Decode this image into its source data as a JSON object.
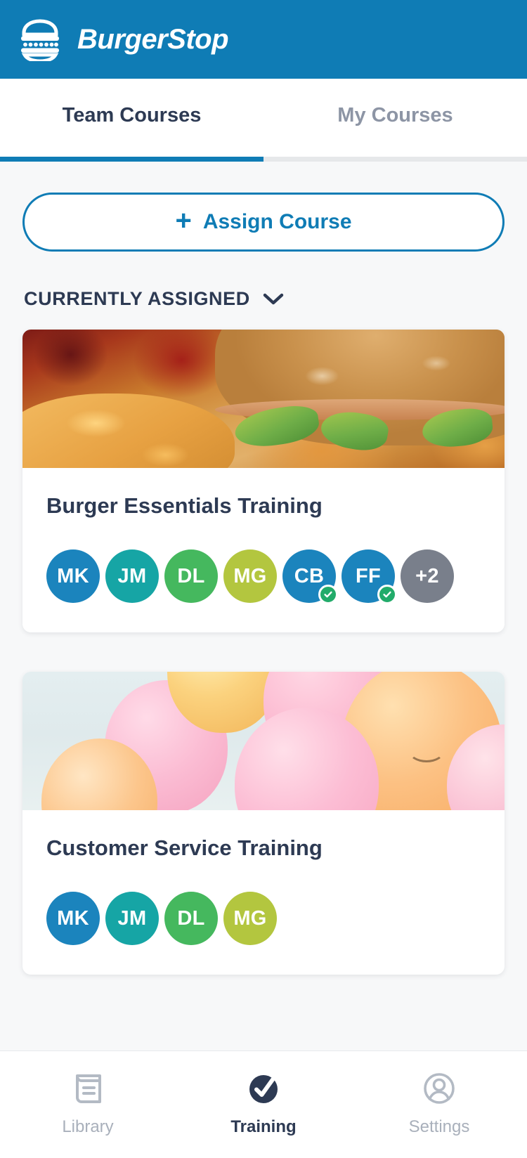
{
  "header": {
    "brand": "BurgerStop",
    "logo_icon": "burger-logo-icon",
    "bg_color": "#0f7cb5"
  },
  "tabs": {
    "items": [
      {
        "label": "Team Courses",
        "active": true
      },
      {
        "label": "My Courses",
        "active": false
      }
    ],
    "indicator_color": "#0f7cb5",
    "track_color": "#e6e8ea"
  },
  "toolbar": {
    "assign_label": "Assign Course",
    "assign_plus_icon": "plus-icon",
    "accent_color": "#0f7cb5"
  },
  "section": {
    "title": "CURRENTLY ASSIGNED",
    "chevron_icon": "chevron-down-icon"
  },
  "courses": [
    {
      "title": "Burger Essentials Training",
      "image": "burger-photo",
      "members": [
        {
          "initials": "MK",
          "color": "#1b84bd",
          "completed": false
        },
        {
          "initials": "JM",
          "color": "#16a5a5",
          "completed": false
        },
        {
          "initials": "DL",
          "color": "#45b85e",
          "completed": false
        },
        {
          "initials": "MG",
          "color": "#b3c63f",
          "completed": false
        },
        {
          "initials": "CB",
          "color": "#1b84bd",
          "completed": true
        },
        {
          "initials": "FF",
          "color": "#1b84bd",
          "completed": true
        }
      ],
      "overflow_label": "+2",
      "overflow_color": "#797f8b"
    },
    {
      "title": "Customer Service Training",
      "image": "balloons-photo",
      "members": [
        {
          "initials": "MK",
          "color": "#1b84bd",
          "completed": false
        },
        {
          "initials": "JM",
          "color": "#16a5a5",
          "completed": false
        },
        {
          "initials": "DL",
          "color": "#45b85e",
          "completed": false
        },
        {
          "initials": "MG",
          "color": "#b3c63f",
          "completed": false
        }
      ],
      "overflow_label": "",
      "overflow_color": ""
    }
  ],
  "bottom_nav": {
    "items": [
      {
        "label": "Library",
        "icon": "book-icon",
        "active": false
      },
      {
        "label": "Training",
        "icon": "check-circle-icon",
        "active": true
      },
      {
        "label": "Settings",
        "icon": "user-circle-icon",
        "active": false
      }
    ],
    "active_color": "#2d3a53",
    "inactive_color": "#a9b0bb"
  },
  "badge": {
    "icon": "check-icon",
    "color": "#22ab6a"
  }
}
